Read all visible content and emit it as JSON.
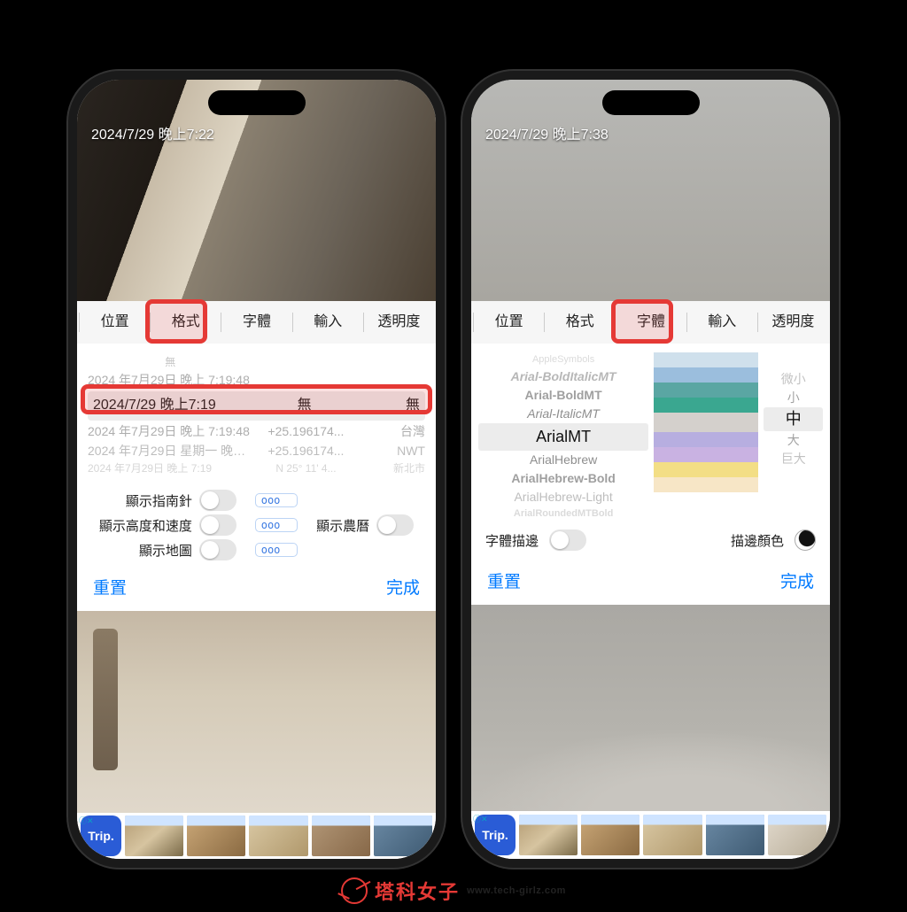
{
  "left_phone": {
    "timestamp_overlay": "2024/7/29 晚上7:22",
    "tabs": [
      "位置",
      "格式",
      "字體",
      "輸入",
      "透明度"
    ],
    "active_tab_index": 1,
    "picker_rows": [
      {
        "c1": "無",
        "c2": "",
        "c3": ""
      },
      {
        "c1": "2024 年7月29日 晚上 7:19:48",
        "c2": "",
        "c3": ""
      },
      {
        "c1": "2024/7/29 晚上7:19",
        "c2": "無",
        "c3": "無"
      },
      {
        "c1": "2024 年7月29日 晚上 7:19:48",
        "c2": "+25.196174...",
        "c3": "台灣"
      },
      {
        "c1": "2024 年7月29日 星期一 晚上 7:19...",
        "c2": "+25.196174...",
        "c3": "NWT"
      },
      {
        "c1": "2024 年7月29日 晚上 7:19",
        "c2": "N 25° 11' 4...",
        "c3": "新北市"
      }
    ],
    "selected_row_index": 2,
    "toggles": {
      "compass_label": "顯示指南針",
      "altitude_label": "顯示高度和速度",
      "map_label": "顯示地圖",
      "lunar_label": "顯示農曆",
      "ooo_text": "ooo"
    },
    "reset_label": "重置",
    "done_label": "完成",
    "ad_brand": "Trip."
  },
  "right_phone": {
    "timestamp_overlay": "2024/7/29 晚上7:38",
    "tabs": [
      "位置",
      "格式",
      "字體",
      "輸入",
      "透明度"
    ],
    "active_tab_index": 2,
    "font_list": [
      "AppleSymbols",
      "Arial-BoldItalicMT",
      "Arial-BoldMT",
      "Arial-ItalicMT",
      "ArialMT",
      "ArialHebrew",
      "ArialHebrew-Bold",
      "ArialHebrew-Light",
      "ArialRoundedMTBold"
    ],
    "selected_font_index": 4,
    "swatches": [
      "#cfe0ec",
      "#9bbedd",
      "#5aa6a3",
      "#3aa790",
      "#d4d0cc",
      "#b7aee0",
      "#c9b2e2",
      "#f3de85",
      "#f7e6c6"
    ],
    "size_list": [
      "微小",
      "小",
      "中",
      "大",
      "巨大"
    ],
    "selected_size_index": 2,
    "outline_label": "字體描邊",
    "outline_color_label": "描邊顏色",
    "reset_label": "重置",
    "done_label": "完成",
    "ad_brand": "Trip."
  },
  "watermark": {
    "title": "塔科女子",
    "url": "www.tech-girlz.com"
  }
}
